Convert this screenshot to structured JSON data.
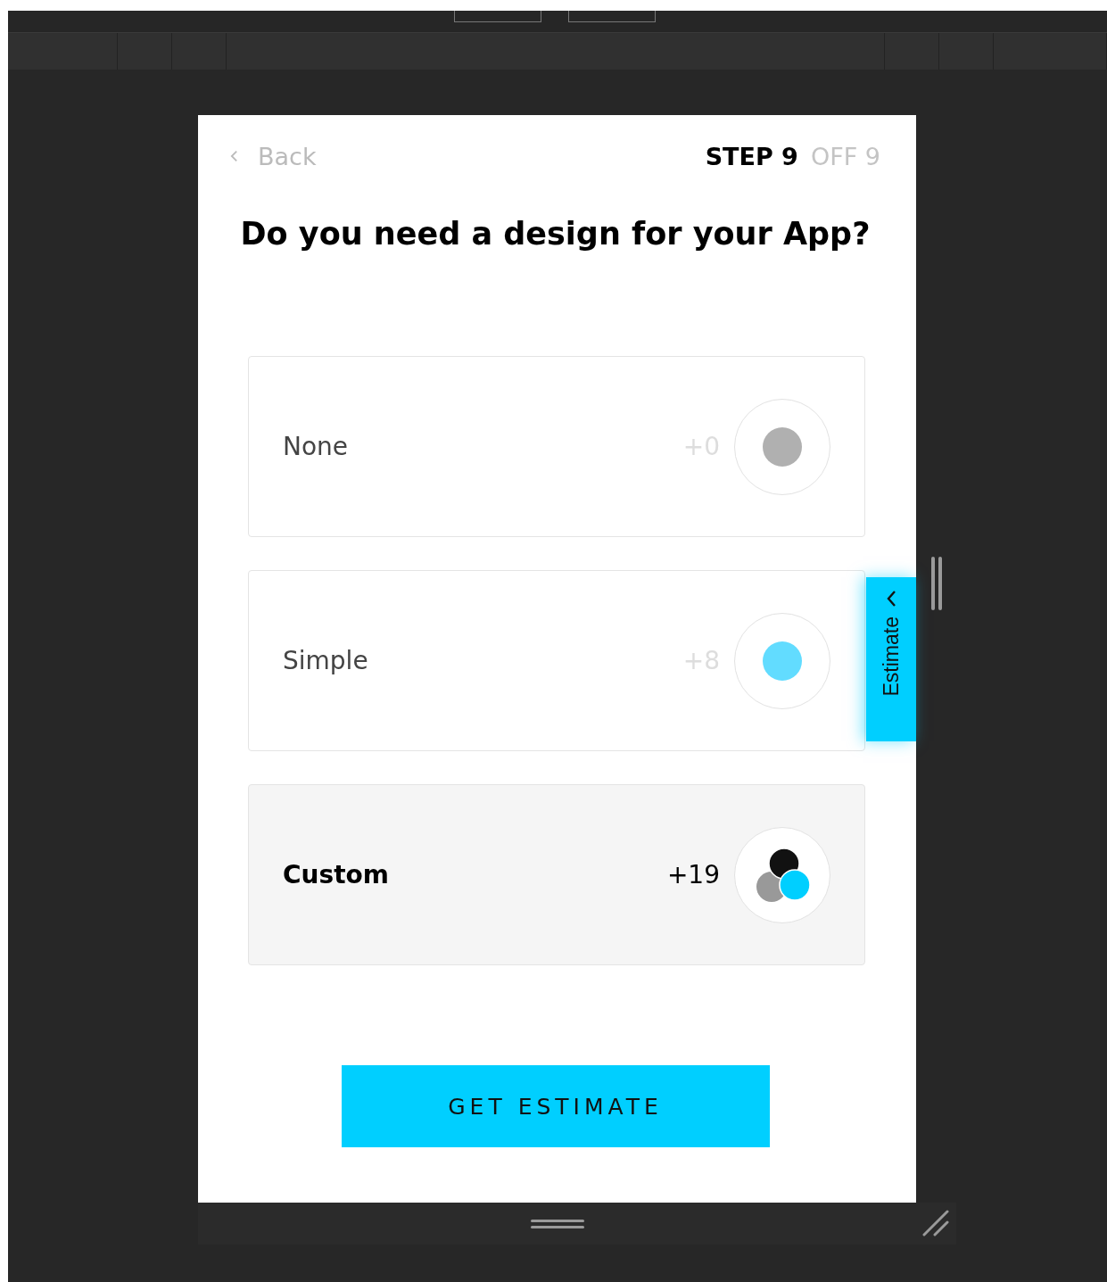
{
  "header": {
    "back": "Back",
    "step": "STEP 9",
    "total": "OFF 9"
  },
  "question": "Do you need a design for your App?",
  "options": [
    {
      "label": "None",
      "price": "+0",
      "kind": "grey-dot",
      "selected": false
    },
    {
      "label": "Simple",
      "price": "+8",
      "kind": "blue-dot",
      "selected": false
    },
    {
      "label": "Custom",
      "price": "+19",
      "kind": "trio",
      "selected": true
    }
  ],
  "estimate_tab": "Estimate",
  "submit": "GET ESTIMATE"
}
